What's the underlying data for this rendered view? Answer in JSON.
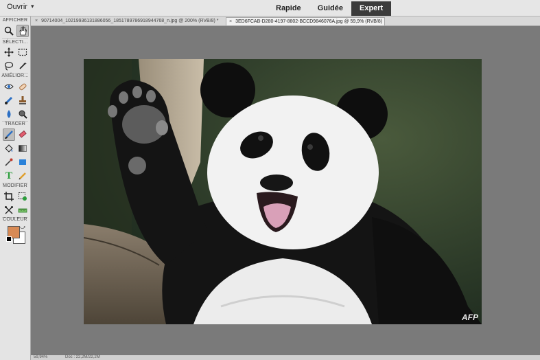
{
  "topbar": {
    "open_label": "Ouvrir",
    "open_caret": "▾",
    "modes": [
      "Rapide",
      "Guidée",
      "Expert"
    ],
    "active_mode": "Expert"
  },
  "toolbar": {
    "sections": [
      "AFFICHER",
      "SÉLECTI...",
      "AMÉLIOR...",
      "TRACER",
      "MODIFIER",
      "COULEUR"
    ],
    "text_tool_glyph": "T",
    "colors": {
      "foreground": "#d88a55",
      "background": "#ffffff"
    },
    "swap_glyph": "⤻"
  },
  "tabs": [
    {
      "close": "×",
      "label": "90714004_10219936131886056_1851789786918944768_n.jpg @ 200% (RVB/8) *"
    },
    {
      "close": "×",
      "label": "3ED6FCAB-D280-4197-8802-BCCD9846076A.jpg @ 59,9% (RVB/8)"
    }
  ],
  "canvas": {
    "watermark": "AFP"
  },
  "statusbar": {
    "zoom": "59,94%",
    "doc": "Doc : 22,2M/22,2M"
  }
}
